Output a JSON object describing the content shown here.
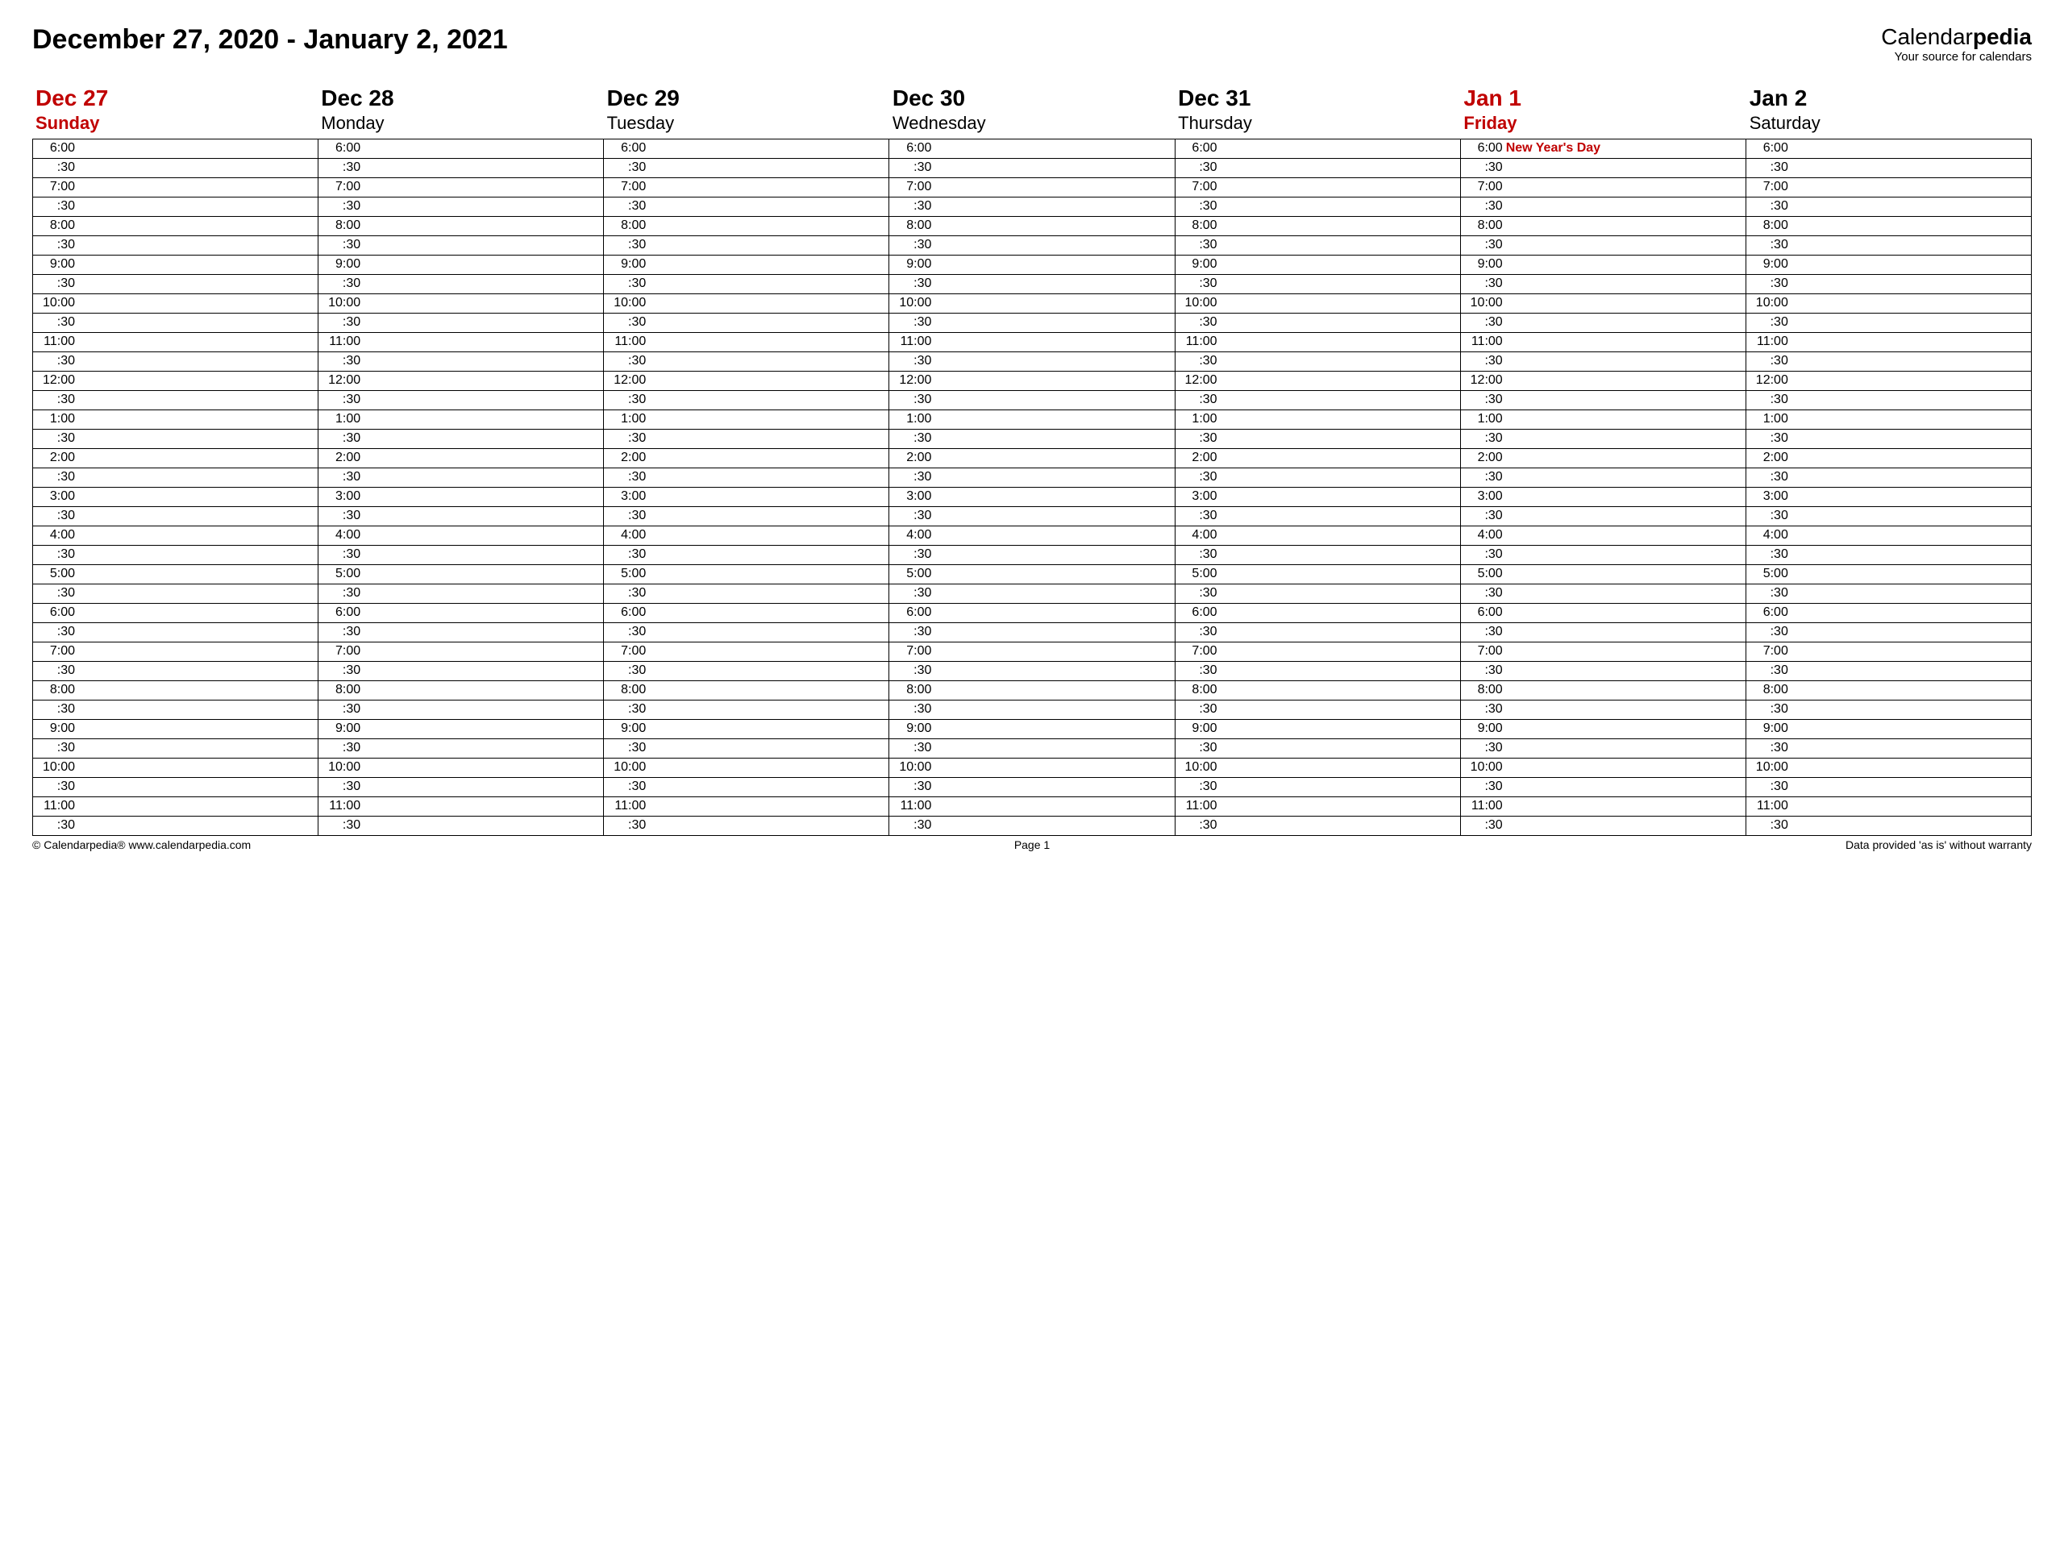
{
  "title": "December 27, 2020 - January 2, 2021",
  "brand": {
    "part1": "Calendar",
    "part2": "pedia",
    "tagline": "Your source for calendars"
  },
  "days": [
    {
      "date": "Dec 27",
      "name": "Sunday",
      "highlight": true,
      "event_slot": "",
      "event_text": ""
    },
    {
      "date": "Dec 28",
      "name": "Monday",
      "highlight": false,
      "event_slot": "",
      "event_text": ""
    },
    {
      "date": "Dec 29",
      "name": "Tuesday",
      "highlight": false,
      "event_slot": "",
      "event_text": ""
    },
    {
      "date": "Dec 30",
      "name": "Wednesday",
      "highlight": false,
      "event_slot": "",
      "event_text": ""
    },
    {
      "date": "Dec 31",
      "name": "Thursday",
      "highlight": false,
      "event_slot": "",
      "event_text": ""
    },
    {
      "date": "Jan 1",
      "name": "Friday",
      "highlight": true,
      "event_slot": "6:00",
      "event_text": "New Year's Day"
    },
    {
      "date": "Jan 2",
      "name": "Saturday",
      "highlight": false,
      "event_slot": "",
      "event_text": ""
    }
  ],
  "time_slots": [
    "6:00",
    ":30",
    "7:00",
    ":30",
    "8:00",
    ":30",
    "9:00",
    ":30",
    "10:00",
    ":30",
    "11:00",
    ":30",
    "12:00",
    ":30",
    "1:00",
    ":30",
    "2:00",
    ":30",
    "3:00",
    ":30",
    "4:00",
    ":30",
    "5:00",
    ":30",
    "6:00",
    ":30",
    "7:00",
    ":30",
    "8:00",
    ":30",
    "9:00",
    ":30",
    "10:00",
    ":30",
    "11:00",
    ":30"
  ],
  "footer": {
    "left": "© Calendarpedia®   www.calendarpedia.com",
    "center": "Page 1",
    "right": "Data provided 'as is' without warranty"
  }
}
